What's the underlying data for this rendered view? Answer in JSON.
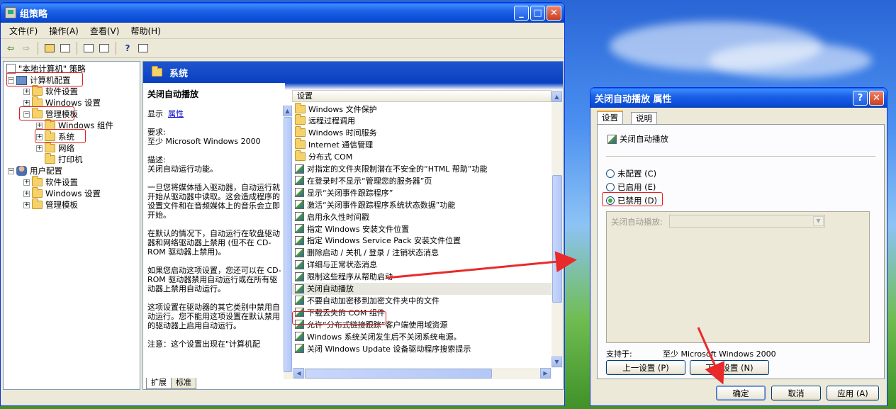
{
  "main_window": {
    "title": "组策略",
    "menu": [
      "文件(F)",
      "操作(A)",
      "查看(V)",
      "帮助(H)"
    ],
    "tree": {
      "root": "\"本地计算机\" 策略",
      "computer_config": "计算机配置",
      "software_settings": "软件设置",
      "windows_settings": "Windows 设置",
      "admin_templates": "管理模板",
      "windows_components": "Windows 组件",
      "system": "系统",
      "network": "网络",
      "printers": "打印机",
      "user_config": "用户配置",
      "user_software_settings": "软件设置",
      "user_windows_settings": "Windows 设置",
      "user_admin_templates": "管理模板"
    },
    "right_header": "系统",
    "description": {
      "title": "关闭自动播放",
      "display_label": "显示",
      "display_link": "属性",
      "req_label": "要求:",
      "req_value": "至少 Microsoft Windows 2000",
      "desc_label": "描述:",
      "desc_value": "关闭自动运行功能。",
      "p1": "一旦您将媒体插入驱动器，自动运行就开始从驱动器中读取。这会造成程序的设置文件和在音频媒体上的音乐会立即开始。",
      "p2": "在默认的情况下，自动运行在软盘驱动器和网络驱动器上禁用 (但不在 CD-ROM 驱动器上禁用)。",
      "p3": "如果您启动这项设置，您还可以在 CD-ROM 驱动器禁用自动运行或在所有驱动器上禁用自动运行。",
      "p4": "这项设置在驱动器的其它类别中禁用自动运行。您不能用这项设置在默认禁用的驱动器上启用自动运行。",
      "p5": "注意：这个设置出现在\"计算机配"
    },
    "list_header": "设置",
    "list_items": [
      {
        "label": "Windows 文件保护",
        "type": "folder"
      },
      {
        "label": "远程过程调用",
        "type": "folder"
      },
      {
        "label": "Windows 时间服务",
        "type": "folder"
      },
      {
        "label": "Internet 通信管理",
        "type": "folder"
      },
      {
        "label": "分布式 COM",
        "type": "folder"
      },
      {
        "label": "对指定的文件夹限制潜在不安全的“HTML 帮助”功能",
        "type": "setting"
      },
      {
        "label": "在登录时不显示“管理您的服务器”页",
        "type": "setting"
      },
      {
        "label": "显示“关闭事件跟踪程序”",
        "type": "setting"
      },
      {
        "label": "激活“关闭事件跟踪程序系统状态数据”功能",
        "type": "setting"
      },
      {
        "label": "启用永久性时间戳",
        "type": "setting"
      },
      {
        "label": "指定 Windows 安装文件位置",
        "type": "setting"
      },
      {
        "label": "指定 Windows Service Pack 安装文件位置",
        "type": "setting"
      },
      {
        "label": "删除启动 / 关机 / 登录 / 注销状态消息",
        "type": "setting"
      },
      {
        "label": "详细与正常状态消息",
        "type": "setting"
      },
      {
        "label": "限制这些程序从帮助启动",
        "type": "setting"
      },
      {
        "label": "关闭自动播放",
        "type": "setting"
      },
      {
        "label": "不要自动加密移到加密文件夹中的文件",
        "type": "setting"
      },
      {
        "label": "下载丢失的 COM 组件",
        "type": "setting"
      },
      {
        "label": "允许“分布式链接跟踪”客户端使用域资源",
        "type": "setting"
      },
      {
        "label": "Windows 系统关闭发生后不关闭系统电源。",
        "type": "setting"
      },
      {
        "label": "关闭 Windows Update 设备驱动程序搜索提示",
        "type": "setting"
      }
    ],
    "bottom_tabs": [
      "扩展",
      "标准"
    ]
  },
  "dialog": {
    "title": "关闭自动播放 属性",
    "tabs": [
      "设置",
      "说明"
    ],
    "setting_name": "关闭自动播放",
    "radio_not_configured": "未配置 (C)",
    "radio_enabled": "已启用 (E)",
    "radio_disabled": "已禁用 (D)",
    "selected": "disabled",
    "option_label": "关闭自动播放:",
    "supported_label": "支持于:",
    "supported_value": "至少 Microsoft Windows 2000",
    "prev_button": "上一设置 (P)",
    "next_button": "下一设置 (N)",
    "ok_button": "确定",
    "cancel_button": "取消",
    "apply_button": "应用 (A)"
  },
  "colors": {
    "highlight": "#e02020",
    "xp_title_blue": "#0a4ad4",
    "radio_checked": "#3cae36"
  }
}
